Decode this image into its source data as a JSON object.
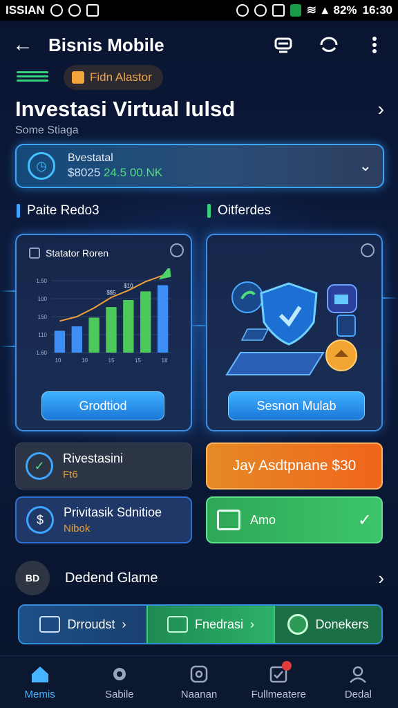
{
  "status_bar": {
    "carrier": "ISSIAN",
    "battery": "82%",
    "time": "16:30"
  },
  "app_bar": {
    "title": "Bisnis Mobile"
  },
  "badge_master": {
    "label": "Fidn Alastor"
  },
  "heading": {
    "title": "Investasi Virtual Iulsd",
    "subtitle": "Some Stiaga"
  },
  "balance": {
    "label": "Bvestatal",
    "value_prefix": "$8025",
    "value_highlight": "24.5 00.NK"
  },
  "sections": {
    "left": "Paite Redo3",
    "right": "Oitferdes"
  },
  "chart_card": {
    "title": "Statator Roren",
    "button": "Grodtiod"
  },
  "security_card": {
    "button": "Sesnon Mulab"
  },
  "chart_data": {
    "type": "bar",
    "categories": [
      "",
      "",
      "",
      "",
      "",
      "",
      ""
    ],
    "values": [
      250,
      300,
      400,
      520,
      600,
      700,
      770
    ],
    "ytick_labels": [
      "1.50",
      "100",
      "150",
      "110",
      "1.60"
    ],
    "xtick_labels": [
      "10",
      "10",
      "15",
      "15",
      "18"
    ],
    "data_labels": [
      "$$5",
      "$10"
    ],
    "ylim": [
      0,
      900
    ],
    "colors": [
      "#3f8ef5",
      "#3f8ef5",
      "#4cc95a",
      "#4cc95a",
      "#4cc95a",
      "#4cc95a",
      "#3f8ef5"
    ]
  },
  "tiles": {
    "investasi": {
      "title": "Rivestasini",
      "sub": "Ft6"
    },
    "orange": {
      "label": "Jay Asdtpnane $30"
    },
    "private": {
      "title": "Privitasik Sdnitioe",
      "sub": "Nibok"
    },
    "green": {
      "label": "Amo"
    }
  },
  "list_row": {
    "icon_text": "BD",
    "label": "Dedend Glame"
  },
  "actions": {
    "a1": "Drroudst",
    "a2": "Fnedrasi",
    "a3": "Donekers"
  },
  "nav": {
    "items": [
      {
        "label": "Memis"
      },
      {
        "label": "Sabile"
      },
      {
        "label": "Naanan"
      },
      {
        "label": "Fullmeatere"
      },
      {
        "label": "Dedal"
      }
    ]
  },
  "colors": {
    "accent_blue": "#3aa6ff",
    "accent_green": "#37d07a",
    "accent_orange": "#f07d1f"
  }
}
